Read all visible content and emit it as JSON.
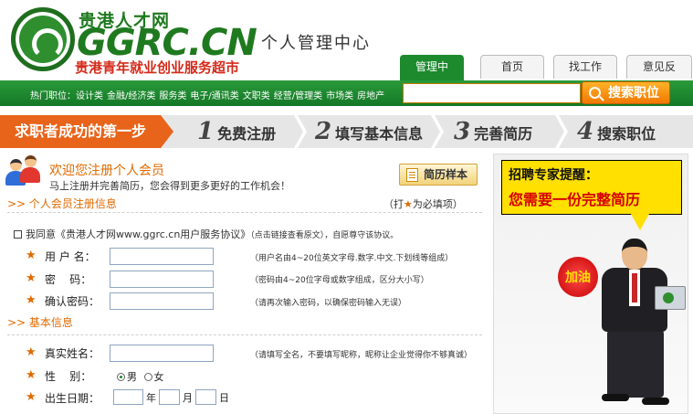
{
  "logo": {
    "cn": "贵港人才网",
    "en": "GGRC.CN",
    "slogan": "贵港青年就业创业服务超市"
  },
  "header": {
    "center_title": "个人管理中心",
    "tabs": [
      {
        "label": "管理中心",
        "active": true
      },
      {
        "label": "首页",
        "active": false
      },
      {
        "label": "找工作",
        "active": false
      },
      {
        "label": "意见反馈",
        "active": false
      }
    ]
  },
  "hotbar": {
    "prefix": "热门职位：",
    "items": [
      "设计类",
      "金融/经济类",
      "服务类",
      "电子/通讯类",
      "文职类",
      "经营/管理类",
      "市场类",
      "房地产"
    ]
  },
  "search": {
    "placeholder": "",
    "button_label": "搜索职位"
  },
  "steps": {
    "first": "求职者成功的第一步",
    "items": [
      {
        "num": "1",
        "label": "免费注册"
      },
      {
        "num": "2",
        "label": "填写基本信息"
      },
      {
        "num": "3",
        "label": "完善简历"
      },
      {
        "num": "4",
        "label": "搜索职位"
      }
    ]
  },
  "welcome": {
    "title": "欢迎您注册个人会员",
    "subtitle": "马上注册并完善简历，您会得到更多更好的工作机会！",
    "sample_button": "简历样本"
  },
  "member_section": {
    "heading": ">> 个人会员注册信息",
    "required_note_pre": "（打",
    "required_star": "★",
    "required_note_post": "为必填项）",
    "agree_text": "我同意《贵港人才网www.ggrc.cn用户服务协议》",
    "agree_hint": "（点击链接查看原文），自愿尊守该协议。",
    "fields": [
      {
        "star": "★",
        "label": "用 户 名：",
        "hint": "（用户名由4~20位英文字母.数字.中文.下划线等组成）"
      },
      {
        "star": "★",
        "label": "密    码：",
        "hint": "（密码由4~20位字母或数字组成，区分大小写）"
      },
      {
        "star": "★",
        "label": "确认密码：",
        "hint": "（请再次输入密码，以确保密码输入无误）"
      }
    ]
  },
  "basic_section": {
    "heading": ">> 基本信息",
    "name": {
      "star": "★",
      "label": "真实姓名：",
      "hint": "（请填写全名，不要填写昵称，昵称让企业觉得你不够真诚）"
    },
    "gender": {
      "star": "★",
      "label": "性    别：",
      "options": [
        "男",
        "女"
      ],
      "selected": "男"
    },
    "dob": {
      "star": "★",
      "label": "出生日期：",
      "year_unit": "年",
      "month_unit": "月",
      "day_unit": "日"
    }
  },
  "ad": {
    "line1": "招聘专家提醒：",
    "line2": "您需要一份完整简历",
    "badge": "加油"
  },
  "colors": {
    "green": "#1c8a2d",
    "orange": "#e06a00",
    "step_orange": "#e8641b",
    "ad_yellow": "#ffe000"
  }
}
